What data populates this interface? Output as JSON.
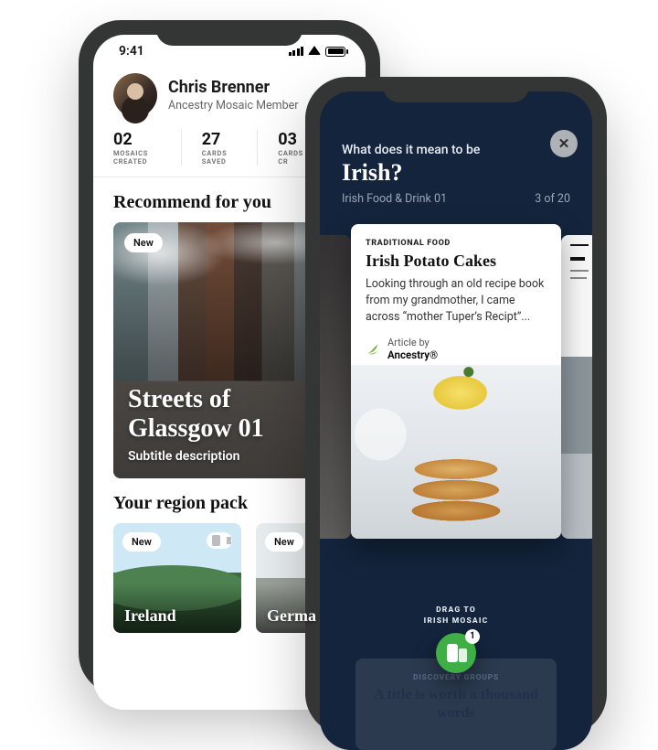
{
  "left": {
    "statusbar": {
      "time": "9:41"
    },
    "profile": {
      "name": "Chris Brenner",
      "role": "Ancestry Mosaic Member"
    },
    "stats": [
      {
        "num": "02",
        "label": "MOSAICS CREATED"
      },
      {
        "num": "27",
        "label": "CARDS SAVED"
      },
      {
        "num": "03",
        "label": "CARDS CR"
      }
    ],
    "sections": {
      "recommend": "Recommend for you",
      "region": "Your region pack"
    },
    "hero": {
      "badge": "New",
      "title": "Streets of Glassgow 01",
      "subtitle": "Subtitle description"
    },
    "packs": [
      {
        "badge": "New",
        "name": "Ireland"
      },
      {
        "badge": "New",
        "name": "Germa"
      }
    ]
  },
  "right": {
    "header": {
      "pre": "What does it mean to be",
      "title": "Irish?",
      "subtitle": "Irish Food & Drink 01",
      "counter": "3 of 20"
    },
    "card": {
      "category": "TRADITIONAL FOOD",
      "title": "Irish Potato Cakes",
      "excerpt": "Looking through an old recipe book from my grandmother, I came across “mother Tuper’s Recipt”...",
      "byline_pre": "Article by",
      "byline_brand": "Ancestry®"
    },
    "footer": {
      "drag_line1": "DRAG TO",
      "drag_line2": "IRISH MOSAIC",
      "count": "1",
      "ghost_category": "DISCOVERY GROUPS",
      "ghost_title": "A title is worth a thousand words"
    }
  }
}
